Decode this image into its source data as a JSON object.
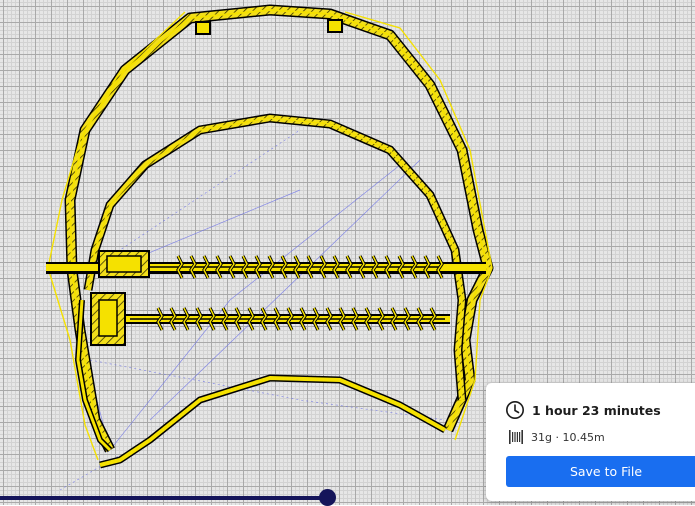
{
  "preview": {
    "accent_color": "#f5e100",
    "outline_color": "#000000",
    "travel_color": "#6f74e8"
  },
  "layer_slider": {
    "value": 0.47,
    "track_color": "#15155a"
  },
  "print_panel": {
    "time_icon": "clock-icon",
    "print_time": "1 hour 23 minutes",
    "material_icon": "spool-icon",
    "material_usage": "31g · 10.45m",
    "save_button_label": "Save to File",
    "button_color": "#196ef0"
  }
}
